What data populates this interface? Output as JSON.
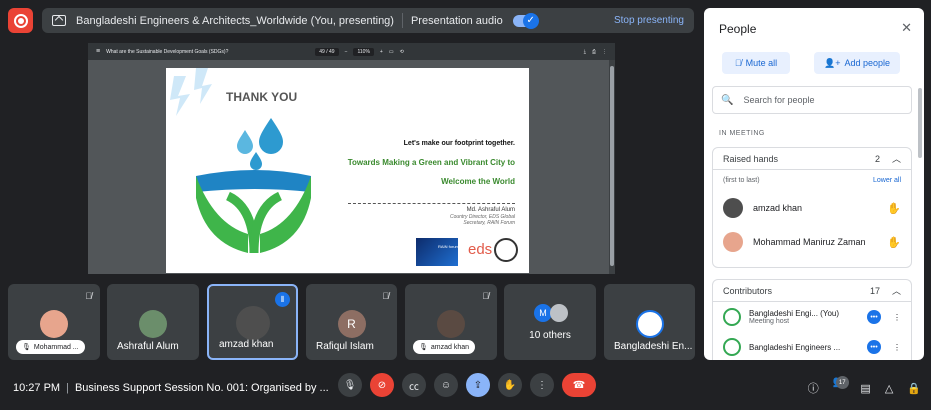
{
  "top_bar": {
    "presentation_title": "Bangladeshi Engineers & Architects_Worldwide (You, presenting)",
    "audio_label": "Presentation audio",
    "stop_label": "Stop presenting"
  },
  "pdf": {
    "doc_title": "What are the Sustainable Development Goals (SDGs)?",
    "page_indicator": "49 / 49",
    "zoom": "110%",
    "slide": {
      "thank_you": "THANK YOU",
      "line1": "Let's make our footprint together.",
      "line2": "Towards Making a Green and Vibrant City to",
      "line3": "Welcome the World",
      "signature_name": "Md. Ashraful Alum",
      "signature_title1": "Country Director, EDS Global",
      "signature_title2": "Secretary, RAIN Forum",
      "logo_text": "RAIN forum",
      "eds_text": "eds"
    }
  },
  "tiles": [
    {
      "name": "Mohammad ...",
      "chip": true,
      "muted": true
    },
    {
      "name": "Ashraful Alum",
      "chip": false,
      "muted": false
    },
    {
      "name": "amzad khan",
      "chip": false,
      "muted": false,
      "active": true
    },
    {
      "name": "Rafiqul Islam",
      "chip": false,
      "muted": true,
      "initial": "R"
    },
    {
      "name": "amzad khan",
      "chip": true,
      "muted": true
    },
    {
      "name": "10 others",
      "others_initial": "M"
    },
    {
      "name": "Bangladeshi En..."
    }
  ],
  "bottom": {
    "time": "10:27 PM",
    "meeting_name": "Business Support Session No. 001: Organised by ...",
    "participant_count": "17"
  },
  "people_panel": {
    "title": "People",
    "mute_all": "Mute all",
    "add_people": "Add people",
    "search_placeholder": "Search for people",
    "in_meeting": "IN MEETING",
    "raised_hands": {
      "label": "Raised hands",
      "count": "2",
      "order_label": "(first to last)",
      "lower_all": "Lower all",
      "people": [
        "amzad khan",
        "Mohammad Maniruz Zaman"
      ]
    },
    "contributors": {
      "label": "Contributors",
      "count": "17",
      "people": [
        {
          "name": "Bangladeshi Engi...",
          "you": "(You)",
          "role": "Meeting host"
        },
        {
          "name": "Bangladeshi Engineers ...",
          "you": "",
          "role": ""
        }
      ]
    }
  }
}
